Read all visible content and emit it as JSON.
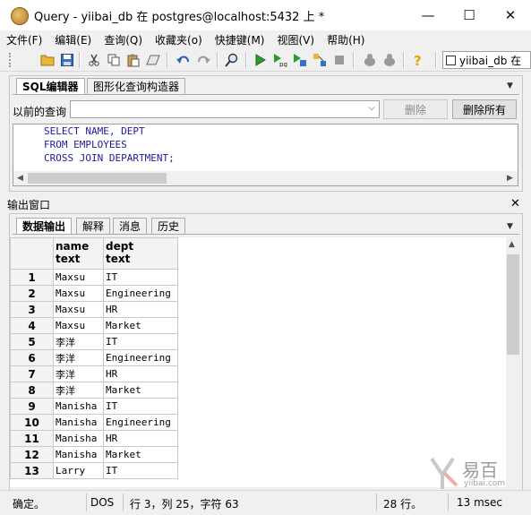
{
  "window": {
    "title": "Query - yiibai_db 在  postgres@localhost:5432 上 *",
    "minimize_glyph": "—",
    "maximize_glyph": "☐",
    "close_glyph": "✕"
  },
  "menu": [
    "文件(F)",
    "编辑(E)",
    "查询(Q)",
    "收藏夹(o)",
    "快捷键(M)",
    "视图(V)",
    "帮助(H)"
  ],
  "toolbar": {
    "database_selector": "yiibai_db 在"
  },
  "editor": {
    "tabs": [
      "SQL编辑器",
      "图形化查询构造器"
    ],
    "active_tab": 0,
    "previous_query_label": "以前的查询",
    "previous_query_value": "",
    "delete_label": "删除",
    "delete_all_label": "删除所有",
    "sql_lines": [
      "SELECT NAME, DEPT",
      "FROM EMPLOYEES",
      "CROSS JOIN DEPARTMENT;"
    ]
  },
  "output": {
    "title": "输出窗口",
    "tabs": [
      "数据输出",
      "解释",
      "消息",
      "历史"
    ],
    "active_tab": 0,
    "columns": [
      {
        "name": "name",
        "type": "text"
      },
      {
        "name": "dept",
        "type": "text"
      }
    ],
    "rows": [
      [
        "1",
        "Maxsu",
        "IT"
      ],
      [
        "2",
        "Maxsu",
        "Engineering"
      ],
      [
        "3",
        "Maxsu",
        "HR"
      ],
      [
        "4",
        "Maxsu",
        "Market"
      ],
      [
        "5",
        "李洋",
        "IT"
      ],
      [
        "6",
        "李洋",
        "Engineering"
      ],
      [
        "7",
        "李洋",
        "HR"
      ],
      [
        "8",
        "李洋",
        "Market"
      ],
      [
        "9",
        "Manisha",
        "IT"
      ],
      [
        "10",
        "Manisha",
        "Engineering"
      ],
      [
        "11",
        "Manisha",
        "HR"
      ],
      [
        "12",
        "Manisha",
        "Market"
      ],
      [
        "13",
        "Larry",
        "IT"
      ]
    ]
  },
  "status": {
    "state": "确定。",
    "line_ending": "DOS",
    "position": "行 3，列 25，字符 63",
    "rows": "28 行。",
    "time": "13 msec"
  },
  "watermark": {
    "text": "易百",
    "sub": "yiibai.com"
  },
  "colors": {
    "sql_keyword": "#1c1c9c",
    "accent": "#1a5fb4"
  }
}
